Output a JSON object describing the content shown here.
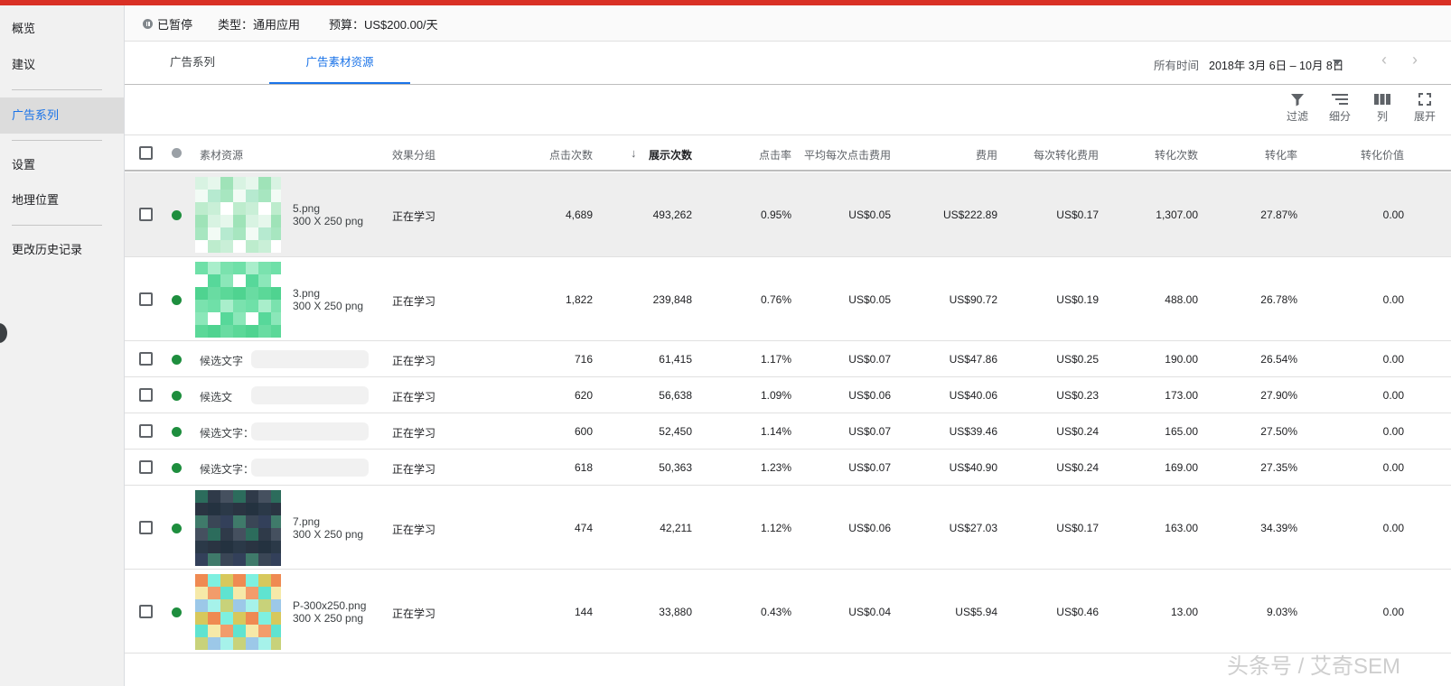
{
  "sidebar": {
    "items": [
      {
        "label": "概览",
        "active": false
      },
      {
        "label": "建议",
        "active": false
      },
      {
        "label": "广告系列",
        "active": true
      },
      {
        "label": "设置",
        "active": false
      },
      {
        "label": "地理位置",
        "active": false
      },
      {
        "label": "更改历史记录",
        "active": false
      }
    ]
  },
  "status": {
    "state": "已暂停",
    "type": "类型：通用应用",
    "budget": "预算：US$200.00/天"
  },
  "tabs": [
    {
      "label": "广告系列",
      "active": false
    },
    {
      "label": "广告素材资源",
      "active": true
    }
  ],
  "date": {
    "label": "所有时间",
    "range": "2018年 3月 6日 – 10月 8日"
  },
  "toolbar": {
    "filter": "过滤",
    "segment": "细分",
    "columns": "列",
    "expand": "展开"
  },
  "columns": {
    "asset": "素材资源",
    "perf": "效果分组",
    "clicks": "点击次数",
    "impressions": "展示次数",
    "ctr": "点击率",
    "avg_cpc": "平均每次点击费用",
    "cost": "费用",
    "cost_per_conv": "每次转化费用",
    "conversions": "转化次数",
    "conv_rate": "转化率",
    "conv_value": "转化价值"
  },
  "rows": [
    {
      "kind": "image",
      "name": "5.png",
      "size": "300 X 250 png",
      "perf": "正在学习",
      "clicks": "4,689",
      "impressions": "493,262",
      "ctr": "0.95%",
      "avg_cpc": "US$0.05",
      "cost": "US$222.89",
      "cost_per_conv": "US$0.17",
      "conversions": "1,307.00",
      "conv_rate": "27.87%",
      "conv_value": "0.00",
      "highlight": true,
      "thumb": "green"
    },
    {
      "kind": "image",
      "name": "3.png",
      "size": "300 X 250 png",
      "perf": "正在学习",
      "clicks": "1,822",
      "impressions": "239,848",
      "ctr": "0.76%",
      "avg_cpc": "US$0.05",
      "cost": "US$90.72",
      "cost_per_conv": "US$0.19",
      "conversions": "488.00",
      "conv_rate": "26.78%",
      "conv_value": "0.00",
      "highlight": false,
      "thumb": "green2"
    },
    {
      "kind": "text",
      "name": "候选文字",
      "perf": "正在学习",
      "clicks": "716",
      "impressions": "61,415",
      "ctr": "1.17%",
      "avg_cpc": "US$0.07",
      "cost": "US$47.86",
      "cost_per_conv": "US$0.25",
      "conversions": "190.00",
      "conv_rate": "26.54%",
      "conv_value": "0.00",
      "highlight": false
    },
    {
      "kind": "text",
      "name": "候选文",
      "perf": "正在学习",
      "clicks": "620",
      "impressions": "56,638",
      "ctr": "1.09%",
      "avg_cpc": "US$0.06",
      "cost": "US$40.06",
      "cost_per_conv": "US$0.23",
      "conversions": "173.00",
      "conv_rate": "27.90%",
      "conv_value": "0.00",
      "highlight": false
    },
    {
      "kind": "text",
      "name": "候选文字：",
      "perf": "正在学习",
      "clicks": "600",
      "impressions": "52,450",
      "ctr": "1.14%",
      "avg_cpc": "US$0.07",
      "cost": "US$39.46",
      "cost_per_conv": "US$0.24",
      "conversions": "165.00",
      "conv_rate": "27.50%",
      "conv_value": "0.00",
      "highlight": false
    },
    {
      "kind": "text",
      "name": "候选文字：",
      "perf": "正在学习",
      "clicks": "618",
      "impressions": "50,363",
      "ctr": "1.23%",
      "avg_cpc": "US$0.07",
      "cost": "US$40.90",
      "cost_per_conv": "US$0.24",
      "conversions": "169.00",
      "conv_rate": "27.35%",
      "conv_value": "0.00",
      "highlight": false
    },
    {
      "kind": "image",
      "name": "7.png",
      "size": "300 X 250 png",
      "perf": "正在学习",
      "clicks": "474",
      "impressions": "42,211",
      "ctr": "1.12%",
      "avg_cpc": "US$0.06",
      "cost": "US$27.03",
      "cost_per_conv": "US$0.17",
      "conversions": "163.00",
      "conv_rate": "34.39%",
      "conv_value": "0.00",
      "highlight": false,
      "thumb": "dark"
    },
    {
      "kind": "image",
      "name": "P-300x250.png",
      "size": "300 X 250 png",
      "perf": "正在学习",
      "clicks": "144",
      "impressions": "33,880",
      "ctr": "0.43%",
      "avg_cpc": "US$0.04",
      "cost": "US$5.94",
      "cost_per_conv": "US$0.46",
      "conversions": "13.00",
      "conv_rate": "9.03%",
      "conv_value": "0.00",
      "highlight": false,
      "thumb": "multi"
    }
  ],
  "watermark": "头条号 / 艾奇SEM",
  "colors": {
    "brand_red": "#d93025",
    "accent_blue": "#1a73e8",
    "status_green": "#1e8e3e"
  },
  "icons": [
    "pause-icon",
    "chevron-down-icon",
    "chevron-left-icon",
    "chevron-right-icon",
    "filter-icon",
    "segment-icon",
    "columns-icon",
    "expand-icon",
    "sort-down-arrow-icon"
  ]
}
